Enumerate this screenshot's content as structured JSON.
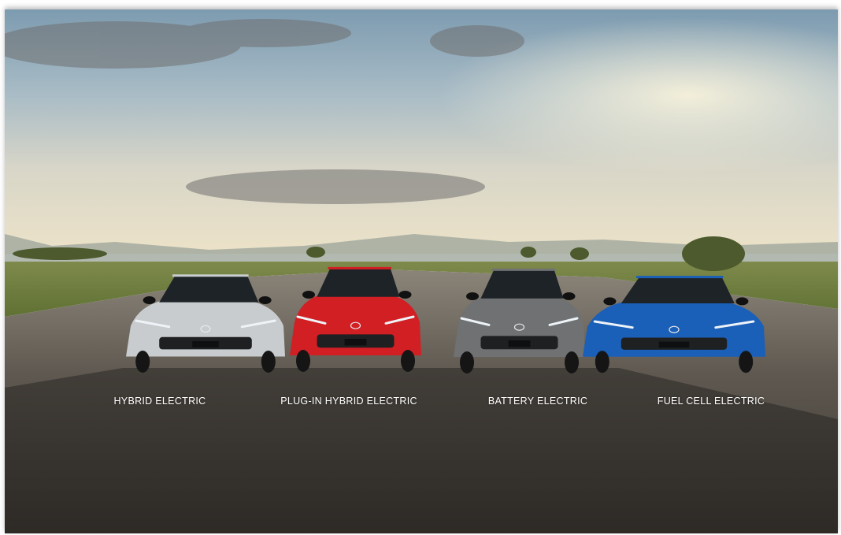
{
  "categories": [
    {
      "label": "HYBRID ELECTRIC",
      "car_color": "#c9ccce"
    },
    {
      "label": "PLUG-IN HYBRID ELECTRIC",
      "car_color": "#d11f24"
    },
    {
      "label": "BATTERY ELECTRIC",
      "car_color": "#6f7172"
    },
    {
      "label": "FUEL CELL ELECTRIC",
      "car_color": "#1a5fb8"
    }
  ],
  "icons": [
    "toyota-logo-icon"
  ]
}
